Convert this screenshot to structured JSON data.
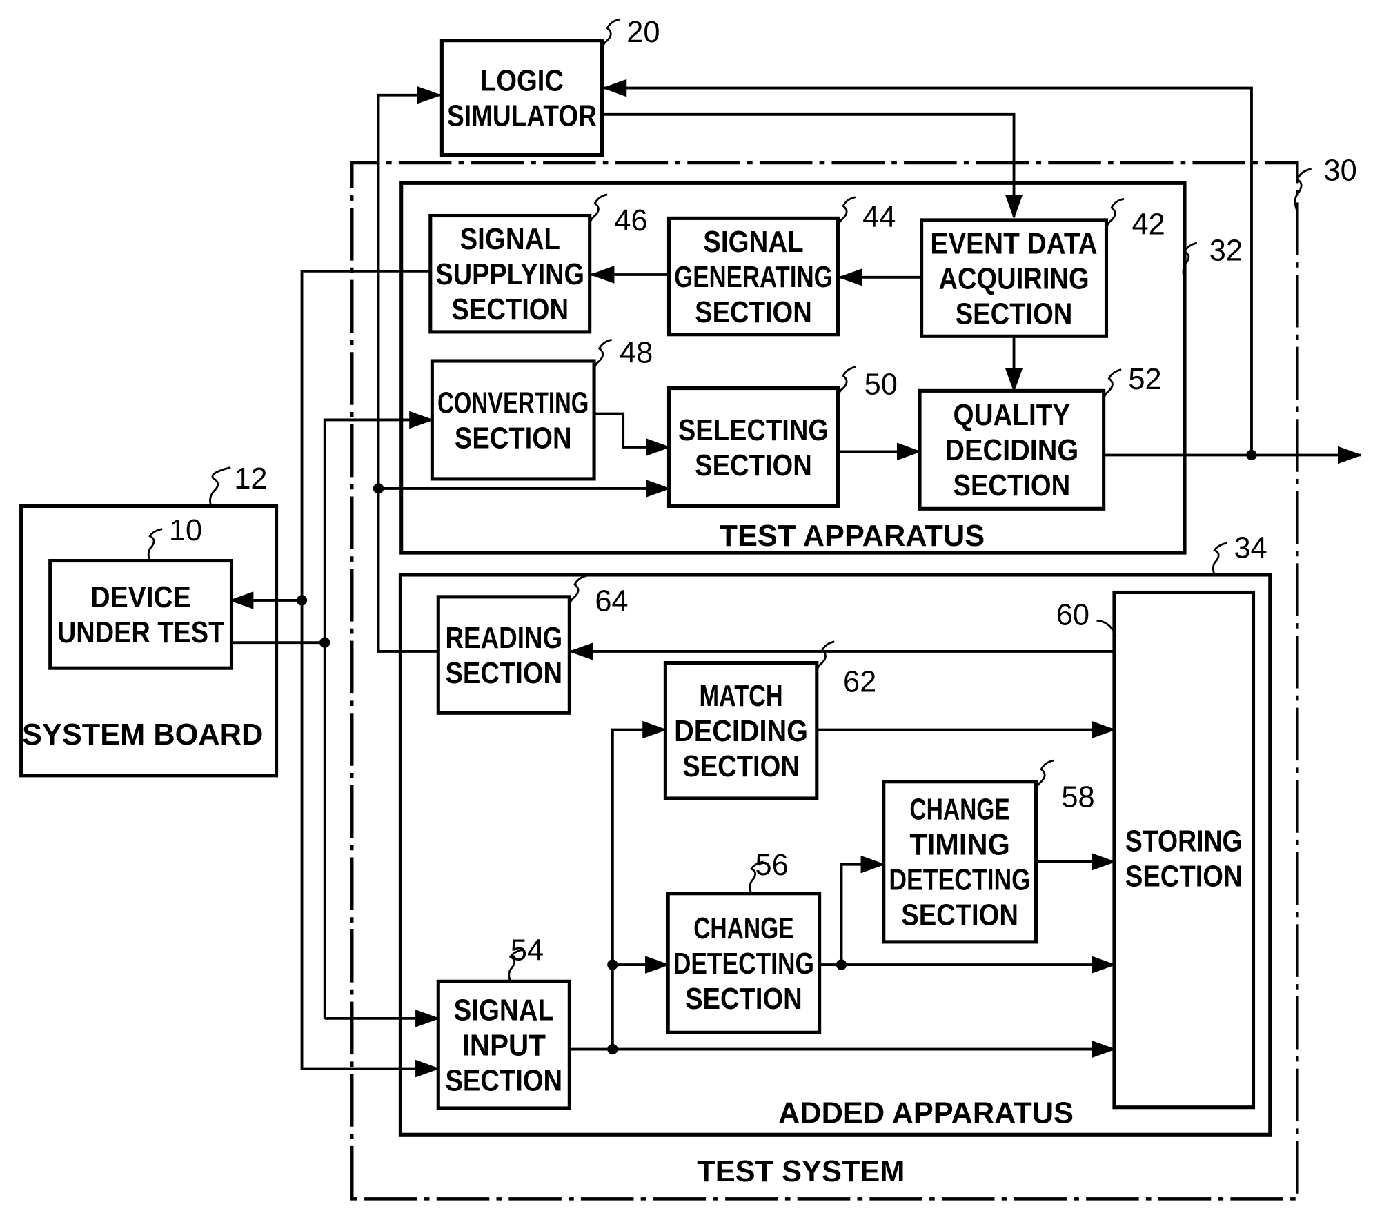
{
  "figure": {
    "blocks": [
      {
        "id": "b20",
        "ref": "20",
        "lines": [
          "LOGIC",
          "SIMULATOR"
        ]
      },
      {
        "id": "b46",
        "ref": "46",
        "lines": [
          "SIGNAL",
          "SUPPLYING",
          "SECTION"
        ]
      },
      {
        "id": "b44",
        "ref": "44",
        "lines": [
          "SIGNAL",
          "GENERATING",
          "SECTION"
        ]
      },
      {
        "id": "b42",
        "ref": "42",
        "lines": [
          "EVENT DATA",
          "ACQUIRING",
          "SECTION"
        ]
      },
      {
        "id": "b48",
        "ref": "48",
        "lines": [
          "CONVERTING",
          "SECTION"
        ]
      },
      {
        "id": "b50",
        "ref": "50",
        "lines": [
          "SELECTING",
          "SECTION"
        ]
      },
      {
        "id": "b52",
        "ref": "52",
        "lines": [
          "QUALITY",
          "DECIDING",
          "SECTION"
        ]
      },
      {
        "id": "b10",
        "ref": "10",
        "lines": [
          "DEVICE",
          "UNDER TEST"
        ]
      },
      {
        "id": "b64",
        "ref": "64",
        "lines": [
          "READING",
          "SECTION"
        ]
      },
      {
        "id": "b62",
        "ref": "62",
        "lines": [
          "MATCH",
          "DECIDING",
          "SECTION"
        ]
      },
      {
        "id": "b58",
        "ref": "58",
        "lines": [
          "CHANGE",
          "TIMING",
          "DETECTING",
          "SECTION"
        ]
      },
      {
        "id": "b56",
        "ref": "56",
        "lines": [
          "CHANGE",
          "DETECTING",
          "SECTION"
        ]
      },
      {
        "id": "b54",
        "ref": "54",
        "lines": [
          "SIGNAL",
          "INPUT",
          "SECTION"
        ]
      },
      {
        "id": "b60",
        "ref": "60",
        "lines": [
          "STORING",
          "SECTION"
        ]
      }
    ],
    "containers": {
      "system_board": {
        "ref": "12",
        "caption": "SYSTEM BOARD"
      },
      "test_system": {
        "ref": "30",
        "caption": "TEST SYSTEM"
      },
      "test_apparatus": {
        "ref": "32",
        "caption": "TEST APPARATUS"
      },
      "added_apparatus": {
        "ref": "34",
        "caption": "ADDED APPARATUS"
      }
    }
  }
}
